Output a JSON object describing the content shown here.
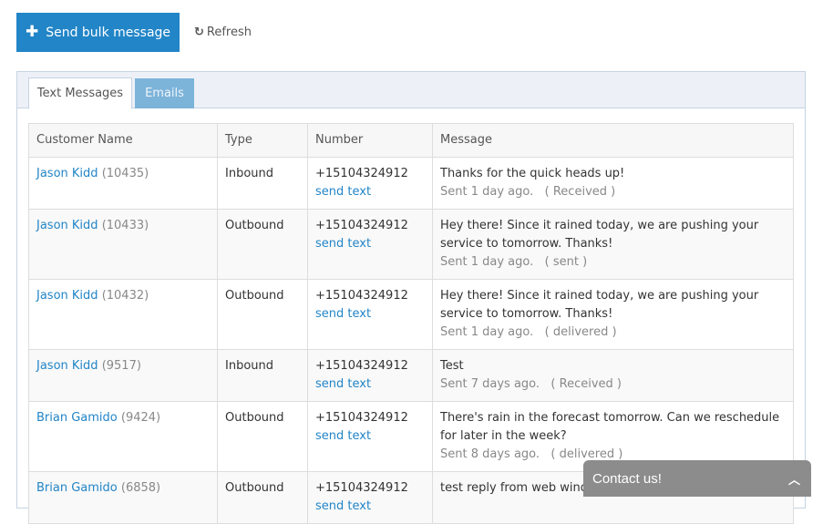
{
  "toolbar": {
    "bulk_icon": "plus-icon",
    "bulk_label": "Send bulk message",
    "refresh_icon": "refresh-icon",
    "refresh_label": "Refresh",
    "primary_color": "#2285c7"
  },
  "tabs": [
    {
      "label": "Text Messages",
      "active": true
    },
    {
      "label": "Emails",
      "active": false
    }
  ],
  "table": {
    "headers": [
      "Customer Name",
      "Type",
      "Number",
      "Message"
    ],
    "rows": [
      {
        "name": "Jason Kidd",
        "id": "(10435)",
        "type": "Inbound",
        "number": "+15104324912",
        "action": "send text",
        "message": "Thanks for the quick heads up!",
        "sent": "Sent 1 day ago.",
        "status": "( Received )"
      },
      {
        "name": "Jason Kidd",
        "id": "(10433)",
        "type": "Outbound",
        "number": "+15104324912",
        "action": "send text",
        "message": "Hey there! Since it rained today, we are pushing your service to tomorrow. Thanks!",
        "sent": "Sent 1 day ago.",
        "status": "( sent )"
      },
      {
        "name": "Jason Kidd",
        "id": "(10432)",
        "type": "Outbound",
        "number": "+15104324912",
        "action": "send text",
        "message": "Hey there! Since it rained today, we are pushing your service to tomorrow. Thanks!",
        "sent": "Sent 1 day ago.",
        "status": "( delivered )"
      },
      {
        "name": "Jason Kidd",
        "id": "(9517)",
        "type": "Inbound",
        "number": "+15104324912",
        "action": "send text",
        "message": "Test",
        "sent": "Sent 7 days ago.",
        "status": "( Received )"
      },
      {
        "name": "Brian Gamido",
        "id": "(9424)",
        "type": "Outbound",
        "number": "+15104324912",
        "action": "send text",
        "message": "There's rain in the forecast tomorrow. Can we reschedule for later in the week?",
        "sent": "Sent 8 days ago.",
        "status": "( delivered )"
      },
      {
        "name": "Brian Gamido",
        "id": "(6858)",
        "type": "Outbound",
        "number": "+15104324912",
        "action": "send text",
        "message": "test reply from web window",
        "sent": "",
        "status": ""
      }
    ]
  },
  "contact_widget": {
    "label": "Contact us!",
    "icon": "chevron-up-icon"
  }
}
